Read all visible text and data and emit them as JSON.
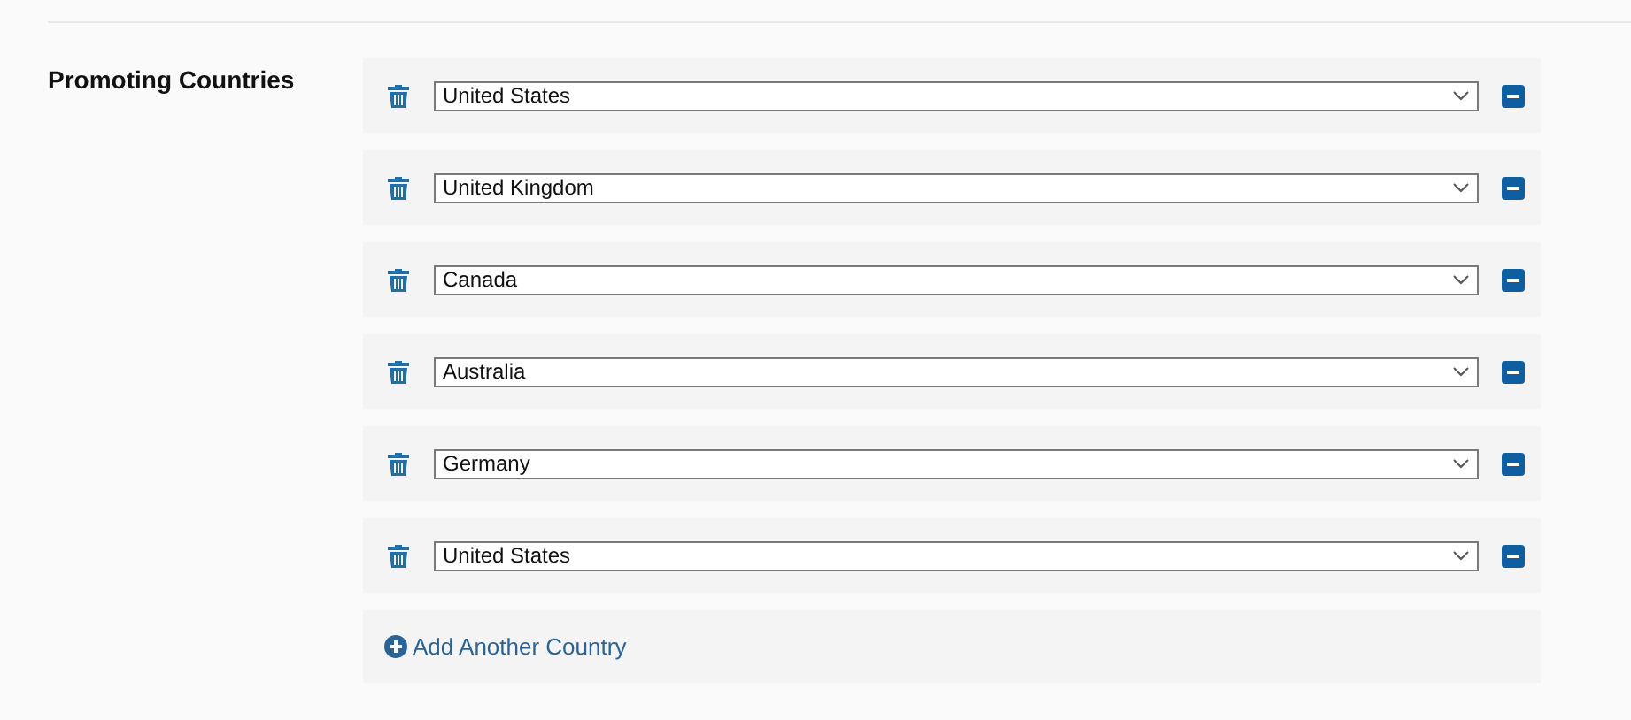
{
  "section": {
    "label": "Promoting Countries",
    "countries": [
      {
        "value": "United States"
      },
      {
        "value": "United Kingdom"
      },
      {
        "value": "Canada"
      },
      {
        "value": "Australia"
      },
      {
        "value": "Germany"
      },
      {
        "value": "United States"
      }
    ],
    "add_link": "Add Another Country"
  }
}
